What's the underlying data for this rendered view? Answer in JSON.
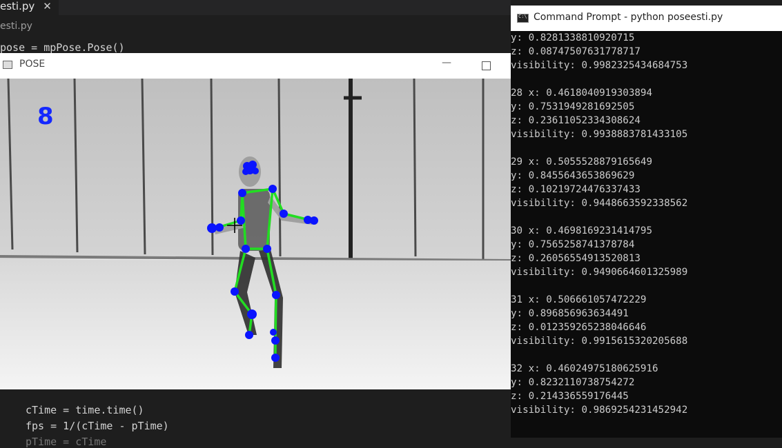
{
  "editor": {
    "tab_label": "esti.py",
    "tab_close": "✕",
    "breadcrumb": "esti.py",
    "code_top": "pose = mpPose.Pose()",
    "code_bottom": [
      "cTime = time.time()",
      "fps = 1/(cTime - pTime)",
      "pTime = cTime"
    ]
  },
  "pose_window": {
    "title": "POSE",
    "minimize_glyph": "—",
    "fps_value": "8",
    "colors": {
      "landmark": "#0a14ff",
      "connection": "#22dd22",
      "fps_text": "#1428ff"
    }
  },
  "cmd": {
    "title": "Command Prompt - python  poseesti.py",
    "lines": [
      "y: 0.8281338810920715",
      "z: 0.08747507631778717",
      "visibility: 0.9982325434684753",
      "",
      "28 x: 0.4618040919303894",
      "y: 0.7531949281692505",
      "z: 0.23611052334308624",
      "visibility: 0.9938883781433105",
      "",
      "29 x: 0.5055528879165649",
      "y: 0.8455643653869629",
      "z: 0.10219724476337433",
      "visibility: 0.9448663592338562",
      "",
      "30 x: 0.4698169231414795",
      "y: 0.7565258741378784",
      "z: 0.26056554913520813",
      "visibility: 0.9490664601325989",
      "",
      "31 x: 0.506661057472229",
      "y: 0.896856963634491",
      "z: 0.012359265238046646",
      "visibility: 0.9915615320205688",
      "",
      "32 x: 0.46024975180625916",
      "y: 0.8232110738754272",
      "z: 0.214336559176445",
      "visibility: 0.9869254231452942"
    ]
  }
}
